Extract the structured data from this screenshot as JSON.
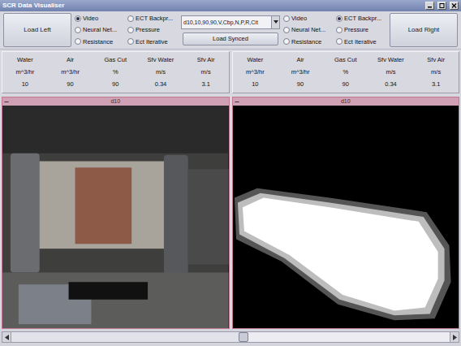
{
  "window": {
    "title": "SCR Data Visualiser"
  },
  "left": {
    "load_button": "Load Left",
    "options": [
      {
        "label": "Video",
        "selected": true
      },
      {
        "label": "ECT Backpr...",
        "selected": false
      },
      {
        "label": "Neural Net...",
        "selected": false
      },
      {
        "label": "Pressure",
        "selected": false
      },
      {
        "label": "Resistance",
        "selected": false
      },
      {
        "label": "Ect Iterative",
        "selected": false
      }
    ]
  },
  "sync": {
    "dataset": "d10,10,90,90,V,Cbp,N,P,R,Cit",
    "button": "Load Synced"
  },
  "right": {
    "load_button": "Load Right",
    "options": [
      {
        "label": "Video",
        "selected": false
      },
      {
        "label": "ECT Backpr...",
        "selected": true
      },
      {
        "label": "Neural Net...",
        "selected": false
      },
      {
        "label": "Pressure",
        "selected": false
      },
      {
        "label": "Resistance",
        "selected": false
      },
      {
        "label": "Ect Iterative",
        "selected": false
      }
    ]
  },
  "readings": [
    {
      "columns": [
        {
          "name": "Water",
          "unit": "m^3/hr",
          "value": "10"
        },
        {
          "name": "Air",
          "unit": "m^3/hr",
          "value": "90"
        },
        {
          "name": "Gas Cut",
          "unit": "%",
          "value": "90"
        },
        {
          "name": "Sfv Water",
          "unit": "m/s",
          "value": "0.34"
        },
        {
          "name": "Sfv Air",
          "unit": "m/s",
          "value": "3.1"
        }
      ]
    },
    {
      "columns": [
        {
          "name": "Water",
          "unit": "m^3/hr",
          "value": "10"
        },
        {
          "name": "Air",
          "unit": "m^3/hr",
          "value": "90"
        },
        {
          "name": "Gas Cut",
          "unit": "%",
          "value": "90"
        },
        {
          "name": "Sfv Water",
          "unit": "m/s",
          "value": "0.34"
        },
        {
          "name": "Sfv Air",
          "unit": "m/s",
          "value": "3.1"
        }
      ]
    }
  ],
  "views": [
    {
      "title": "d10",
      "kind": "video"
    },
    {
      "title": "d10",
      "kind": "ect"
    }
  ],
  "timeline": {
    "level": 0.53
  }
}
